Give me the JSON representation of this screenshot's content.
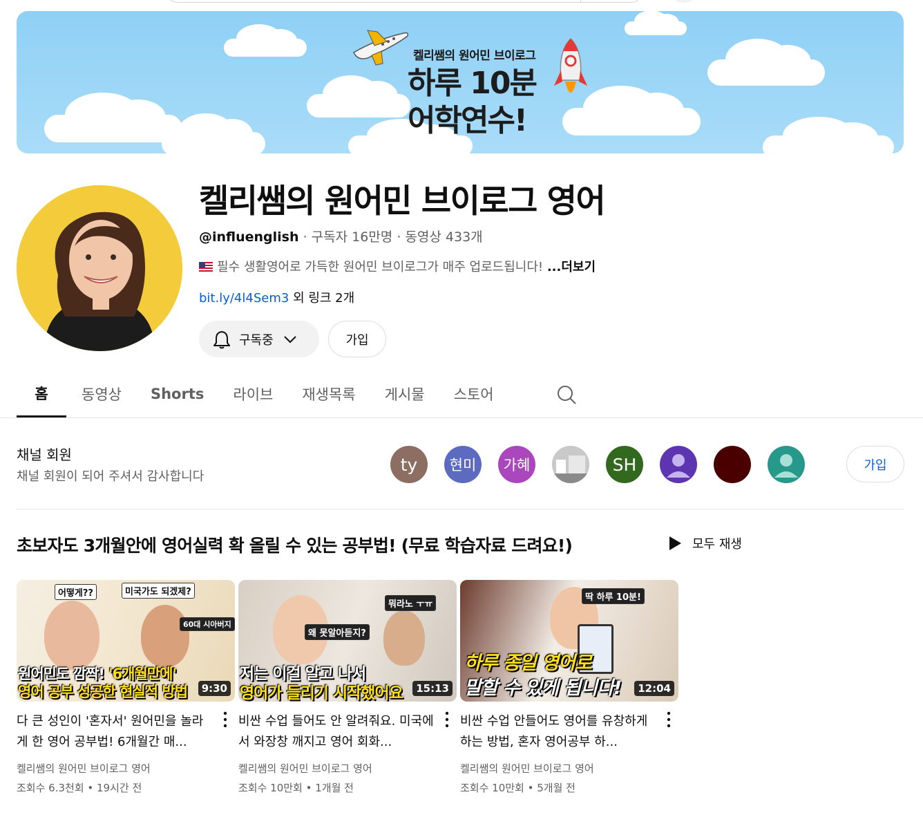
{
  "banner": {
    "subtitle": "켈리쌤의 원어민 브이로그",
    "title_line1": "하루 10분",
    "title_line2": "어학연수!"
  },
  "channel": {
    "name": "켈리쌤의 원어민 브이로그 영어",
    "handle": "@influenglish",
    "subscribers": "구독자 16만명",
    "videos": "동영상 433개",
    "description": "필수 생활영어로 가득한 원어민 브이로그가 매주 업로드됩니다!",
    "more": "...더보기",
    "link": "bit.ly/4l4Sem3",
    "other_links": "외 링크 2개",
    "subscribed_label": "구독중",
    "join_label": "가입"
  },
  "tabs": [
    {
      "label": "홈",
      "active": true
    },
    {
      "label": "동영상"
    },
    {
      "label": "Shorts"
    },
    {
      "label": "라이브"
    },
    {
      "label": "재생목록"
    },
    {
      "label": "게시물"
    },
    {
      "label": "스토어"
    }
  ],
  "members": {
    "title": "채널 회원",
    "subtitle": "채널 회원이 되어 주셔서 감사합니다",
    "avatars": [
      {
        "text": "ty",
        "color": "#8d6e63"
      },
      {
        "text": "현미",
        "color": "#5c6bc0"
      },
      {
        "text": "가혜",
        "color": "#ab47bc"
      },
      {
        "text": "",
        "color": "#b9b9b9"
      },
      {
        "text": "SH",
        "color": "#33691e"
      },
      {
        "text": "",
        "color": "#5e35b1"
      },
      {
        "text": "",
        "color": "#4a0000"
      },
      {
        "text": "",
        "color": "#26998a"
      }
    ],
    "join_label": "가입"
  },
  "playlist": {
    "title": "초보자도 3개월안에 영어실력 확 올릴 수 있는 공부법! (무료 학습자료 드려요!)",
    "play_all": "모두 재생"
  },
  "videos": [
    {
      "thumb_tag1": "어떻게??",
      "thumb_tag2": "미국가도 되겠제?",
      "thumb_tag3": "60대 시아버지",
      "thumb_caption1_a": "원어민도 깜짝! ",
      "thumb_caption1_b": "'6개월만에'",
      "thumb_caption2": "영어 공부 성공한 현실적 방법",
      "duration": "9:30",
      "title": "다 큰 성인이 '혼자서' 원어민을 놀라게 한 영어 공부법! 6개월간 매...",
      "channel": "켈리쌤의 원어민 브이로그 영어",
      "stats": "조회수 6.3천회 • 19시간 전"
    },
    {
      "thumb_tag1": "뭐라노 ㅜㅠ",
      "thumb_tag2": "왜 못알아듣지?",
      "thumb_caption1": "저는 이걸 알고 나서",
      "thumb_caption2": "영어가 들리기 시작했어요",
      "duration": "15:13",
      "title": "비싼 수업 들어도 안 알려줘요. 미국에서 와장창 깨지고 영어 회화...",
      "channel": "켈리쌤의 원어민 브이로그 영어",
      "stats": "조회수 10만회 • 1개월 전"
    },
    {
      "thumb_tag1": "딱 하루 10분!",
      "thumb_caption1": "하루 종일 영어로",
      "thumb_caption2": "말할 수 있게 됩니다!",
      "duration": "12:04",
      "title": "비싼 수업 안들어도 영어를 유창하게 하는 방법, 혼자 영어공부 하...",
      "channel": "켈리쌤의 원어민 브이로그 영어",
      "stats": "조회수 10만회 • 5개월 전"
    }
  ]
}
